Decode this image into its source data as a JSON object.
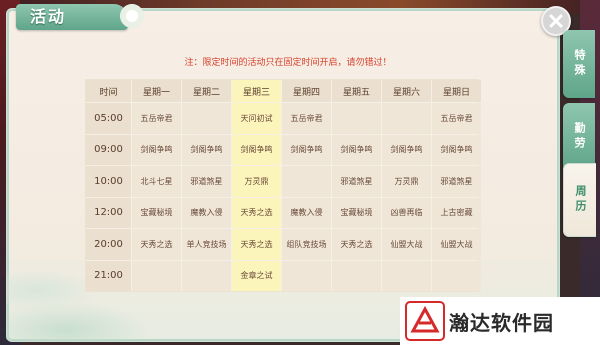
{
  "window": {
    "title": "活动",
    "notice": "注：限定时间的活动只在固定时间开启，请勿错过！"
  },
  "colors": {
    "accent_green": "#5fa58a",
    "notice_red": "#d8402c",
    "highlight_column": "#fbf4bb",
    "cell_bg": "#efe6d8"
  },
  "schedule": {
    "highlighted_day_index": 2,
    "header": {
      "time": "时间",
      "days": [
        "星期一",
        "星期二",
        "星期三",
        "星期四",
        "星期五",
        "星期六",
        "星期日"
      ]
    },
    "rows": [
      {
        "time": "05:00",
        "events": [
          "五岳帝君",
          "",
          "天问初试",
          "五岳帝君",
          "",
          "",
          "五岳帝君"
        ]
      },
      {
        "time": "09:00",
        "events": [
          "剑阁争鸣",
          "剑阁争鸣",
          "剑阁争鸣",
          "剑阁争鸣",
          "剑阁争鸣",
          "剑阁争鸣",
          "剑阁争鸣"
        ]
      },
      {
        "time": "10:00",
        "events": [
          "北斗七星",
          "邪道煞星",
          "万灵鼎",
          "",
          "邪道煞星",
          "万灵鼎",
          "邪道煞星"
        ]
      },
      {
        "time": "12:00",
        "events": [
          "宝藏秘境",
          "魔教入侵",
          "天秀之选",
          "魔教入侵",
          "宝藏秘境",
          "凶兽再临",
          "上古密藏"
        ]
      },
      {
        "time": "20:00",
        "events": [
          "天秀之选",
          "单人竞技场",
          "天秀之选",
          "组队竞技场",
          "天秀之选",
          "仙盟大战",
          "仙盟大战"
        ]
      },
      {
        "time": "21:00",
        "events": [
          "",
          "",
          "金章之试",
          "",
          "",
          "",
          ""
        ]
      }
    ]
  },
  "side_tabs": [
    {
      "label": "特殊",
      "active": false
    },
    {
      "label": "勤劳",
      "active": false
    },
    {
      "label": "周历",
      "active": true
    }
  ],
  "watermark": {
    "text": "瀚达软件园"
  }
}
